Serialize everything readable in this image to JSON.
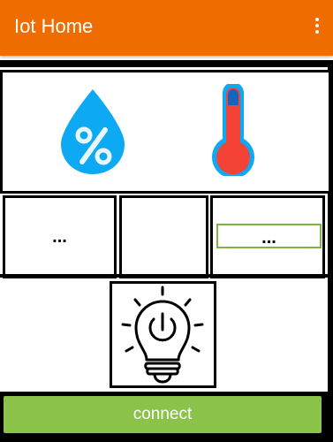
{
  "appbar": {
    "title": "Iot Home",
    "menu_icon": "more-vert-icon",
    "color": "#ef6c00"
  },
  "sensors": {
    "humidity_icon": "humidity-drop-icon",
    "temperature_icon": "thermometer-icon",
    "humidity_value": "...",
    "temperature_value": "..."
  },
  "light": {
    "icon": "lightbulb-power-icon"
  },
  "actions": {
    "connect_label": "connect",
    "connect_color": "#8bc34a"
  }
}
